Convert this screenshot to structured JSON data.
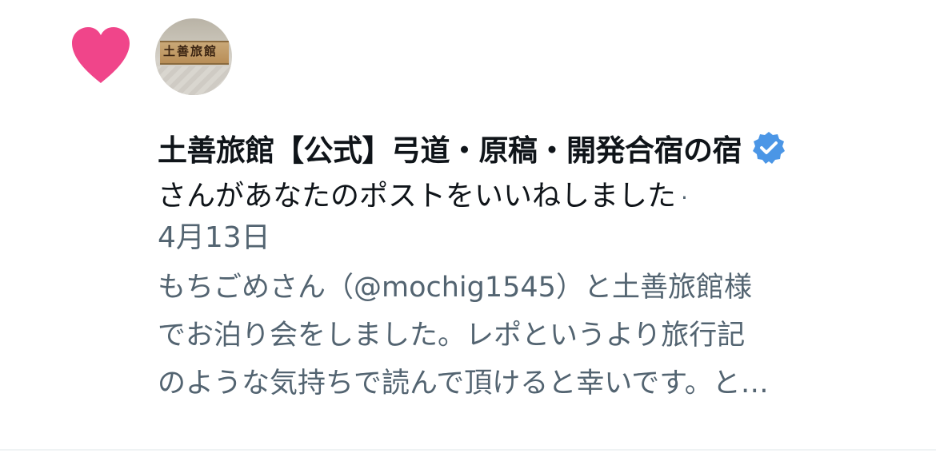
{
  "notification": {
    "type_icon": "heart-icon",
    "heart_color": "#f0458a",
    "avatar": {
      "description_icon": "ryokan-sign-avatar",
      "sign_text": "土善旅館"
    },
    "account_name": "土善旅館【公式】弓道・原稿・開発合宿の宿",
    "verified_icon": "verified-badge-icon",
    "verified_color": "#4b96e6",
    "action_text": "さんがあなたのポストをいいねしました",
    "separator": "·",
    "timestamp": "4月13日",
    "post_preview_lines": [
      "もちごめさん（@mochig1545）と土善旅館様",
      "でお泊り会をしました。レポというより旅行記",
      "のような気持ちで読んで頂けると幸いです。と…"
    ]
  },
  "colors": {
    "primary_text": "#0f1419",
    "secondary_text": "#536471",
    "divider": "#eff3f4"
  }
}
